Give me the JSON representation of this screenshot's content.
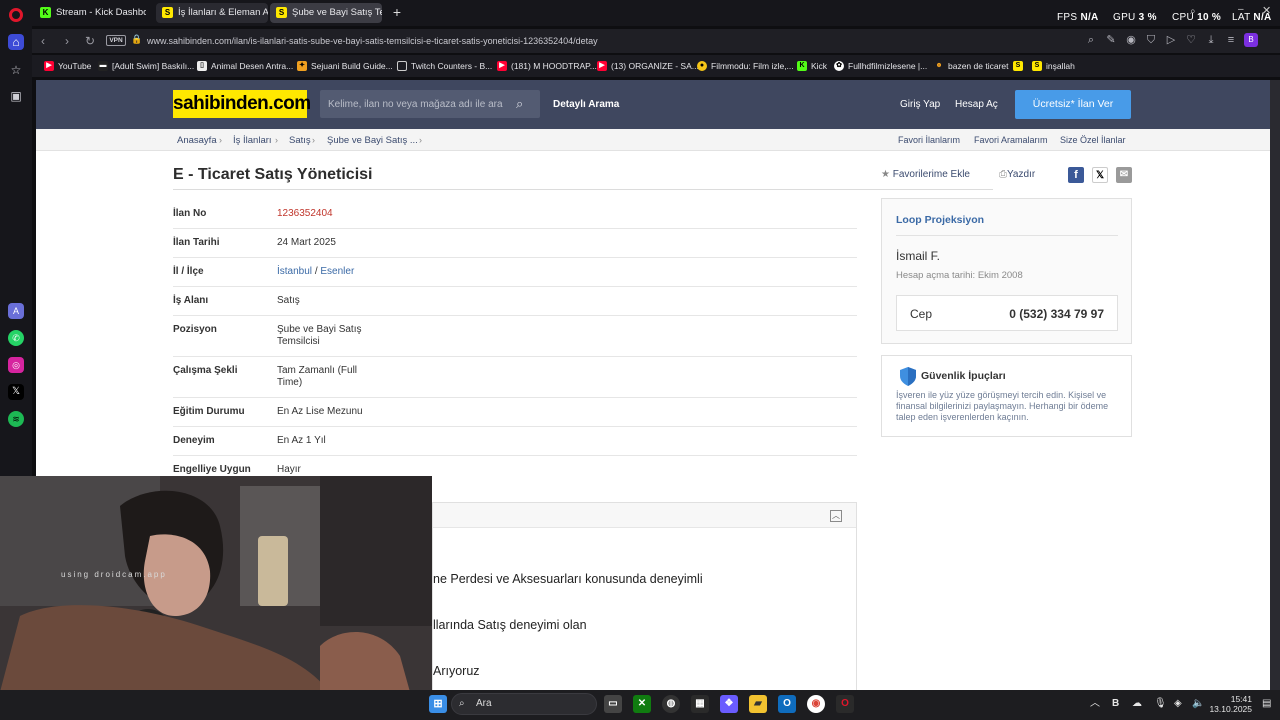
{
  "tabs": [
    {
      "title": "Stream - Kick Dashboard",
      "icon": "K",
      "color": "#53fc18"
    },
    {
      "title": "İş İlanları & Eleman Arayanlar",
      "icon": "S",
      "color": "#ffe800"
    },
    {
      "title": "Şube ve Bayi Satış Temsilcisi",
      "icon": "S",
      "color": "#ffe800"
    }
  ],
  "perf": {
    "fps_label": "FPS",
    "fps": "N/A",
    "gpu_label": "GPU",
    "gpu": "3 %",
    "cpu_label": "CPU",
    "cpu": "10 %",
    "lat_label": "LAT",
    "lat": "N/A"
  },
  "address": {
    "vpn": "VPN",
    "url": "www.sahibinden.com/ilan/is-ilanlari-satis-sube-ve-bayi-satis-temsilcisi-e-ticaret-satis-yoneticisi-1236352404/detay"
  },
  "bookmarks": [
    {
      "label": "YouTube",
      "icon": "youtube-icon",
      "color": "#ff0033"
    },
    {
      "label": "[Adult Swim] Baskılı...",
      "icon": "adultswim-icon",
      "color": "#222"
    },
    {
      "label": "Animal Desen Antra...",
      "icon": "page-icon",
      "color": "#eee"
    },
    {
      "label": "Sejuani Build Guide...",
      "icon": "mobafire-icon",
      "color": "#f0a020"
    },
    {
      "label": "Twitch Counters - B...",
      "icon": "page-icon",
      "color": "#fff"
    },
    {
      "label": "(181) M HOODTRAP...",
      "icon": "youtube-icon",
      "color": "#ff0033"
    },
    {
      "label": "(13) ORGANİZE - SA...",
      "icon": "youtube-icon",
      "color": "#ff0033"
    },
    {
      "label": "Filmmodu: Film izle,...",
      "icon": "filmmodu-icon",
      "color": "#f5c518"
    },
    {
      "label": "Kick",
      "icon": "kick-icon",
      "color": "#53fc18"
    },
    {
      "label": "Fullhdfilmizlesene |...",
      "icon": "film-icon",
      "color": "#fff"
    },
    {
      "label": "bazen de ticaret",
      "icon": "folder-icon",
      "color": "#f0a020"
    },
    {
      "label": "",
      "icon": "sahibinden-icon",
      "color": "#ffe800"
    },
    {
      "label": "inşallah",
      "icon": "sahibinden-icon",
      "color": "#ffe800"
    }
  ],
  "site": {
    "logo": "sahibinden.com",
    "search_placeholder": "Kelime, ilan no veya mağaza adı ile ara",
    "detailed_search": "Detaylı Arama",
    "login": "Giriş Yap",
    "register": "Hesap Aç",
    "post_ad": "Ücretsiz* İlan Ver"
  },
  "breadcrumb": [
    "Anasayfa",
    "İş İlanları",
    "Satış",
    "Şube ve Bayi Satış ..."
  ],
  "quick_links": [
    "Favori İlanlarım",
    "Favori Aramalarım",
    "Size Özel İlanlar"
  ],
  "listing": {
    "title": "E - Ticaret Satış Yöneticisi",
    "add_favorite": "Favorilerime Ekle",
    "print": "Yazdır",
    "details": [
      {
        "label": "İlan No",
        "value": "1236352404"
      },
      {
        "label": "İlan Tarihi",
        "value": "24 Mart 2025"
      },
      {
        "label": "İl / İlçe",
        "value": "",
        "city": "İstanbul",
        "sep": "/",
        "district": "Esenler"
      },
      {
        "label": "İş Alanı",
        "value": "Satış"
      },
      {
        "label": "Pozisyon",
        "value": "Şube ve Bayi Satış Temsilcisi"
      },
      {
        "label": "Çalışma Şekli",
        "value": "Tam Zamanlı (Full Time)"
      },
      {
        "label": "Eğitim Durumu",
        "value": "En Az Lise Mezunu"
      },
      {
        "label": "Deneyim",
        "value": "En Az 1 Yıl"
      },
      {
        "label": "Engelliye Uygun",
        "value": "Hayır"
      }
    ],
    "description_lines": [
      "ne Perdesi ve Aksesuarları konusunda deneyimli",
      "llarında Satış deneyimi olan",
      "Arıyoruz"
    ]
  },
  "seller": {
    "company": "Loop Projeksiyon",
    "name": "İsmail F.",
    "since": "Hesap açma tarihi: Ekim 2008",
    "phone_label": "Cep",
    "phone": "0 (532) 334 79 97"
  },
  "safety": {
    "title": "Güvenlik İpuçları",
    "text": "İşveren ile yüz yüze görüşmeyi tercih edin. Kişisel ve finansal bilgilerinizi paylaşmayın. Herhangi bir ödeme talep eden işverenlerden kaçının."
  },
  "webcam": {
    "overlay": "using droidcam.app"
  },
  "taskbar": {
    "search": "Ara",
    "time": "15:41",
    "date": "13.10.2025"
  }
}
